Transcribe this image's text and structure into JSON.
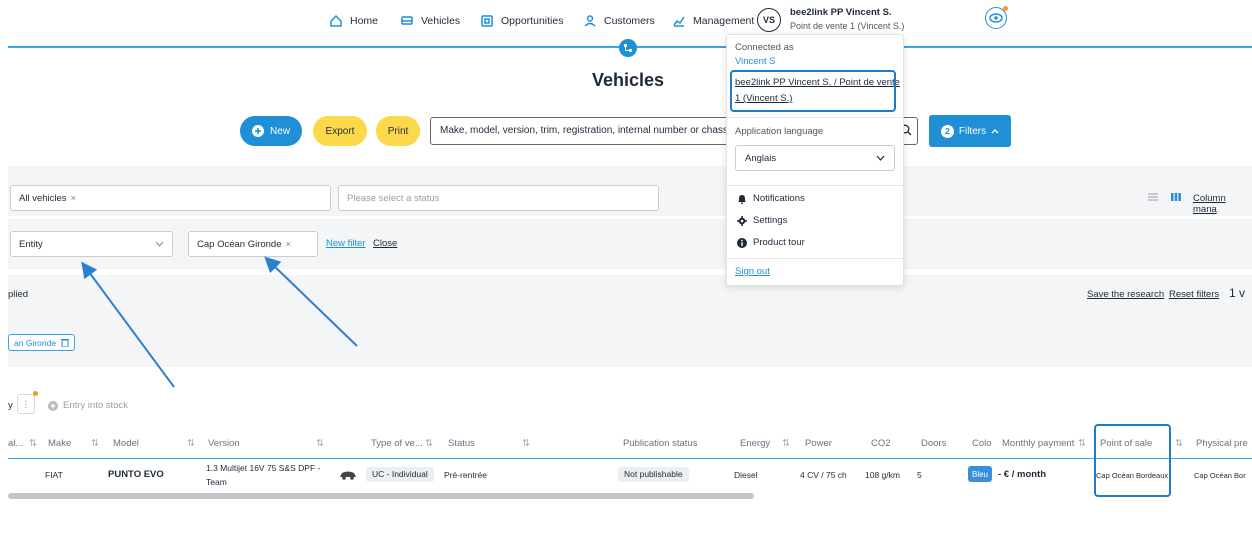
{
  "nav": {
    "items": [
      {
        "label": "Home",
        "icon": "home-icon"
      },
      {
        "label": "Vehicles",
        "icon": "car-icon"
      },
      {
        "label": "Opportunities",
        "icon": "opportunities-icon"
      },
      {
        "label": "Customers",
        "icon": "person-icon"
      },
      {
        "label": "Management",
        "icon": "chart-icon"
      }
    ],
    "avatar": "VS",
    "user_name": "bee2link PP Vincent S.",
    "user_sub": "Point de vente 1 (Vincent S.)"
  },
  "page": {
    "title": "Vehicles"
  },
  "toolbar": {
    "new_label": "New",
    "export_label": "Export",
    "print_label": "Print",
    "search_placeholder": "Make, model, version, trim, registration, internal number or chassis",
    "filters_count": "2",
    "filters_label": "Filters"
  },
  "filters": {
    "view_chip": "All vehicles",
    "status_placeholder": "Please select a status",
    "column_manager": "Column mana",
    "entity_label": "Entity",
    "entity_chip": "Cap Océan Gironde",
    "new_filter": "New filter",
    "close": "Close",
    "applied_text": "plied",
    "save_research": "Save the research",
    "reset_filters": "Reset filters",
    "count": "1 v",
    "applied_chip": "an Gironde"
  },
  "actions": {
    "sort_prefix": "y",
    "entry_into_stock": "Entry into stock"
  },
  "dropdown": {
    "connected_as": "Connected as",
    "user": "Vincent S",
    "account_line1": "bee2link PP Vincent S. / Point de vente",
    "account_line2": "1 (Vincent S.)",
    "language_label": "Application language",
    "language_value": "Anglais",
    "notifications": "Notifications",
    "settings": "Settings",
    "product_tour": "Product tour",
    "sign_out": "Sign out"
  },
  "table": {
    "headers": [
      "al...",
      "Make",
      "Model",
      "Version",
      "Type of ve...",
      "Status",
      "Publication status",
      "Energy",
      "Power",
      "CO2",
      "Doors",
      "Colo",
      "Monthly payment",
      "Point of sale",
      "Physical pre"
    ],
    "row": {
      "make": "FIAT",
      "model": "PUNTO EVO",
      "version_line1": "1.3 Multijet 16V 75 S&S DPF -",
      "version_line2": "Team",
      "type": "UC - Individual",
      "status": "Pré-rentrée",
      "publication": "Not publishable",
      "energy": "Diesel",
      "power": "4 CV / 75 ch",
      "co2": "108 g/km",
      "doors": "5",
      "color": "Bleu",
      "monthly": "- € / month",
      "point_of_sale": "Cap Océan Bordeaux",
      "physical": "Cap Océan Bor"
    }
  },
  "colors": {
    "accent": "#1f8fd6",
    "yellow": "#fcd94b",
    "highlight": "#1f7bc4"
  }
}
